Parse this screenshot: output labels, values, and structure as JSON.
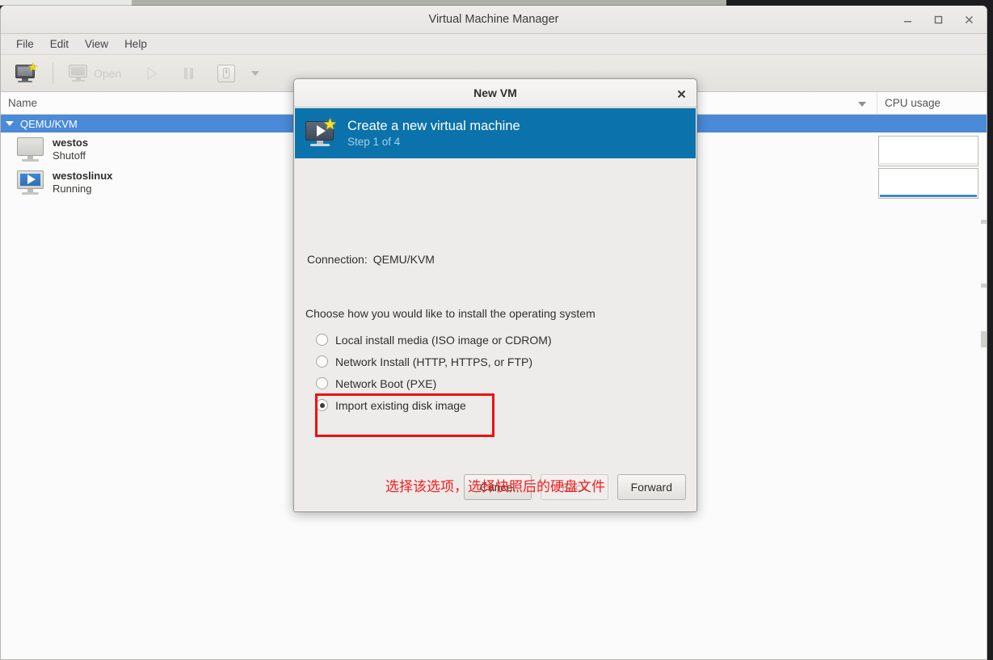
{
  "window": {
    "title": "Virtual Machine Manager",
    "controls": {
      "minimize": "minimize-label",
      "maximize": "maximize-label",
      "close": "close-label"
    }
  },
  "menubar": {
    "items": [
      {
        "label": "File"
      },
      {
        "label": "Edit"
      },
      {
        "label": "View"
      },
      {
        "label": "Help"
      }
    ]
  },
  "toolbar": {
    "new_vm_tooltip": "Create a new virtual machine",
    "open_label": "Open",
    "run_label": "Run",
    "pause_label": "Pause",
    "shutdown_label": "Shut Down",
    "dropdown_label": "More options"
  },
  "columns": {
    "name": "Name",
    "cpu_usage": "CPU usage"
  },
  "connection_group": {
    "label": "QEMU/KVM",
    "expanded": true
  },
  "vms": [
    {
      "name": "westos",
      "state": "Shutoff",
      "icon": "monitor-off-icon"
    },
    {
      "name": "westoslinux",
      "state": "Running",
      "icon": "monitor-running-icon"
    }
  ],
  "dialog": {
    "title": "New VM",
    "close_label": "×",
    "banner": {
      "heading": "Create a new virtual machine",
      "step": "Step 1 of 4",
      "icon": "new-vm-banner-icon"
    },
    "connection": {
      "label": "Connection:",
      "value": "QEMU/KVM"
    },
    "choose_label": "Choose how you would like to install the operating system",
    "options": [
      {
        "label": "Local install media (ISO image or CDROM)",
        "selected": false
      },
      {
        "label": "Network Install (HTTP, HTTPS, or FTP)",
        "selected": false
      },
      {
        "label": "Network Boot (PXE)",
        "selected": false
      },
      {
        "label": "Import existing disk image",
        "selected": true
      }
    ],
    "annotation": "选择该选项，选择快照后的硬盘文件",
    "buttons": {
      "cancel": "Cancel",
      "back": "Back",
      "forward": "Forward",
      "back_disabled": true
    }
  },
  "colors": {
    "banner_blue": "#0b72ab",
    "selection_blue": "#4a8ad8",
    "annotation_red": "#fb1a1a",
    "highlight_red": "#ee1111",
    "running_blue": "#3f87d4"
  }
}
